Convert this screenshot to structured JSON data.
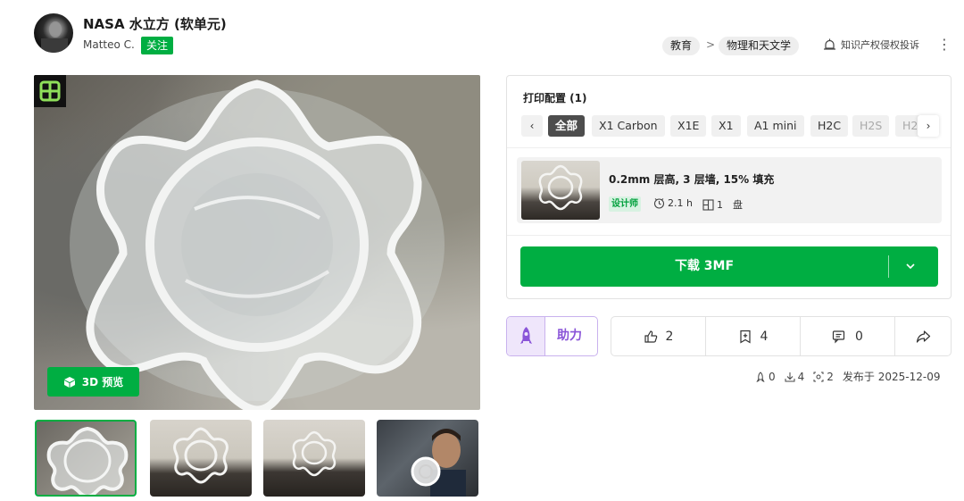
{
  "header": {
    "title": "NASA 水立方 (软单元)",
    "author": "Matteo C.",
    "follow_label": "关注",
    "breadcrumb": [
      "教育",
      "物理和天文学"
    ],
    "breadcrumb_sep": ">",
    "report_label": "知识产权侵权投诉",
    "more_label": "⋮"
  },
  "media": {
    "preview_label": "3D 预览",
    "thumbnail_count": 4,
    "active_thumbnail": 0
  },
  "print_profile": {
    "title": "打印配置 (1)",
    "printers": [
      "全部",
      "X1 Carbon",
      "X1E",
      "X1",
      "A1 mini",
      "H2C",
      "H2S",
      "H2"
    ],
    "selected_printer": "全部",
    "profile": {
      "name": "0.2mm 层高, 3 层墙, 15% 填充",
      "badge": "设计师",
      "time": "2.1 h",
      "plates": "1",
      "plate_unit": "盘"
    },
    "download_label": "下载 3MF"
  },
  "actions": {
    "boost_label": "助力",
    "like_count": "2",
    "collect_count": "4",
    "comment_count": "0"
  },
  "stats": {
    "boosts": "0",
    "downloads": "4",
    "prints": "2",
    "published": "发布于 2025-12-09"
  },
  "colors": {
    "accent": "#00ae42",
    "boost": "#8a55d8"
  }
}
